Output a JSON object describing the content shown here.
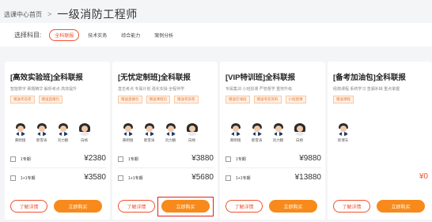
{
  "breadcrumb": {
    "home": "选课中心首页",
    "separator": ">",
    "current": "一级消防工程师"
  },
  "filter": {
    "label": "选择科目:",
    "subjects": [
      "全科联报",
      "技术实务",
      "综合能力",
      "案例分析"
    ],
    "active_subject": "全科联报"
  },
  "colors": {
    "accent": "#f0512f",
    "buy_button": "#f78a1b",
    "tag_bg": "#fff1e6",
    "highlight": "#e02020"
  },
  "cards": [
    {
      "title": "[高效实验班]全科联报",
      "subtitle": "智能数字 刷题精华 解析考点 高效提升",
      "tags": [
        "赠送考前卷",
        "赠送直播包"
      ],
      "teachers": [
        "黄明镜",
        "蔡雪涛",
        "刘力鹏",
        "白杨"
      ],
      "options": [
        {
          "name": "1专期",
          "price": "¥2380"
        },
        {
          "name": "1+1专期",
          "price": "¥3580"
        }
      ],
      "detail_label": "了解详情",
      "buy_label": "立即购买"
    },
    {
      "title": "[无忧定制班]全科联报",
      "subtitle": "直击考点 专属计划 强化实操 全程伴学",
      "tags": [
        "赠送直播包",
        "赠送课程包",
        "赠送考前卷"
      ],
      "teachers": [
        "黄明镜",
        "蔡雪涛",
        "刘力鹏",
        "白杨"
      ],
      "options": [
        {
          "name": "1专期",
          "price": "¥3880"
        },
        {
          "name": "1+1专期",
          "price": "¥5680"
        }
      ],
      "detail_label": "了解详情",
      "buy_label": "立即购买"
    },
    {
      "title": "[VIP特训班]全科联报",
      "subtitle": "专属集训 小班授课 严管督学 重劳升级",
      "tags": [
        "赠送在线班",
        "赠送考前资料",
        "小班授课"
      ],
      "teachers": [
        "黄明镜",
        "蔡雪涛",
        "刘力鹏",
        "白杨"
      ],
      "options": [
        {
          "name": "1专期",
          "price": "¥9880"
        },
        {
          "name": "1+1专期",
          "price": "¥13880"
        }
      ],
      "detail_label": "了解详情",
      "buy_label": "立即购买"
    },
    {
      "title": "[备考加油包]全科联报",
      "subtitle": "经典课程 系统学习 查漏补缺 重点掌握",
      "tags": [
        "赠送课程"
      ],
      "teachers": [
        "新博天"
      ],
      "options": [
        {
          "name": "",
          "price": "¥0"
        }
      ],
      "detail_label": "了解详情",
      "buy_label": "立即购买"
    }
  ]
}
